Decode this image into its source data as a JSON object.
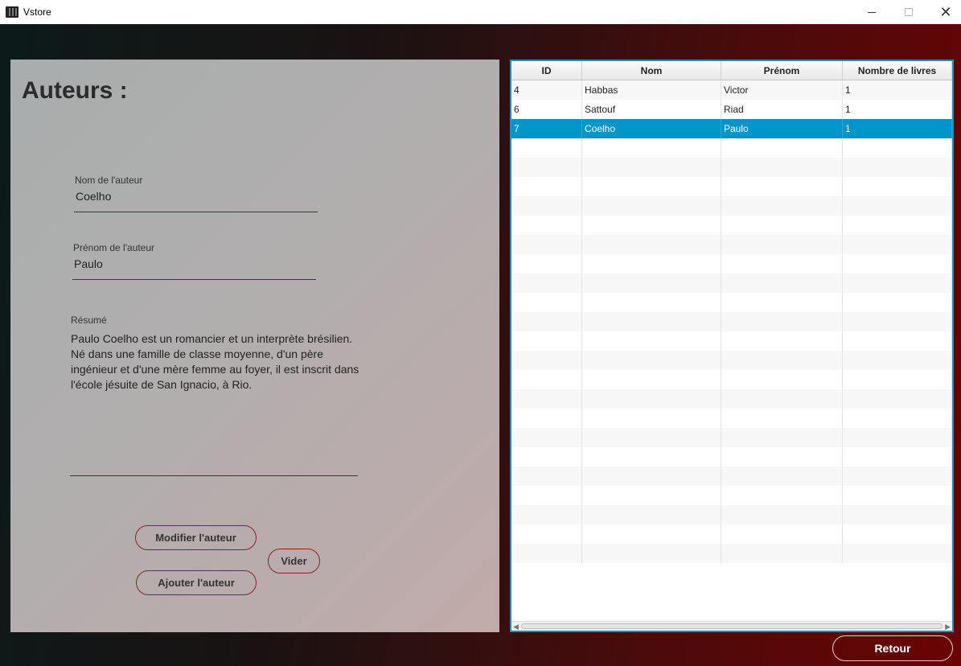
{
  "window": {
    "title": "Vstore",
    "minimize_label": "",
    "maximize_label": "",
    "close_label": "✕"
  },
  "form": {
    "title": "Auteurs :",
    "nom_label": "Nom de l'auteur",
    "nom_value": "Coelho",
    "prenom_label": "Prénom de l'auteur",
    "prenom_value": "Paulo",
    "resume_label": "Résumé",
    "resume_value": "Paulo Coelho est un romancier et un interprète brésilien. Né dans une famille de classe moyenne, d'un père ingénieur et d'une mère femme au foyer, il est inscrit dans l'école jésuite de San Ignacio, à Rio.",
    "modifier_label": "Modifier l'auteur",
    "ajouter_label": "Ajouter l'auteur",
    "vider_label": "Vider"
  },
  "table": {
    "columns": [
      "ID",
      "Nom",
      "Prénom",
      "Nombre de livres"
    ],
    "rows": [
      {
        "id": "4",
        "nom": "Habbas",
        "prenom": "Victor",
        "livres": "1"
      },
      {
        "id": "6",
        "nom": "Sattouf",
        "prenom": "Riad",
        "livres": "1"
      },
      {
        "id": "7",
        "nom": "Coelho",
        "prenom": "Paulo",
        "livres": "1"
      }
    ],
    "selected_row": 2
  },
  "footer": {
    "retour_label": "Retour"
  },
  "colors": {
    "accent": "#0096c9",
    "border": "#8a2424",
    "table_border": "#1a8fc9"
  }
}
